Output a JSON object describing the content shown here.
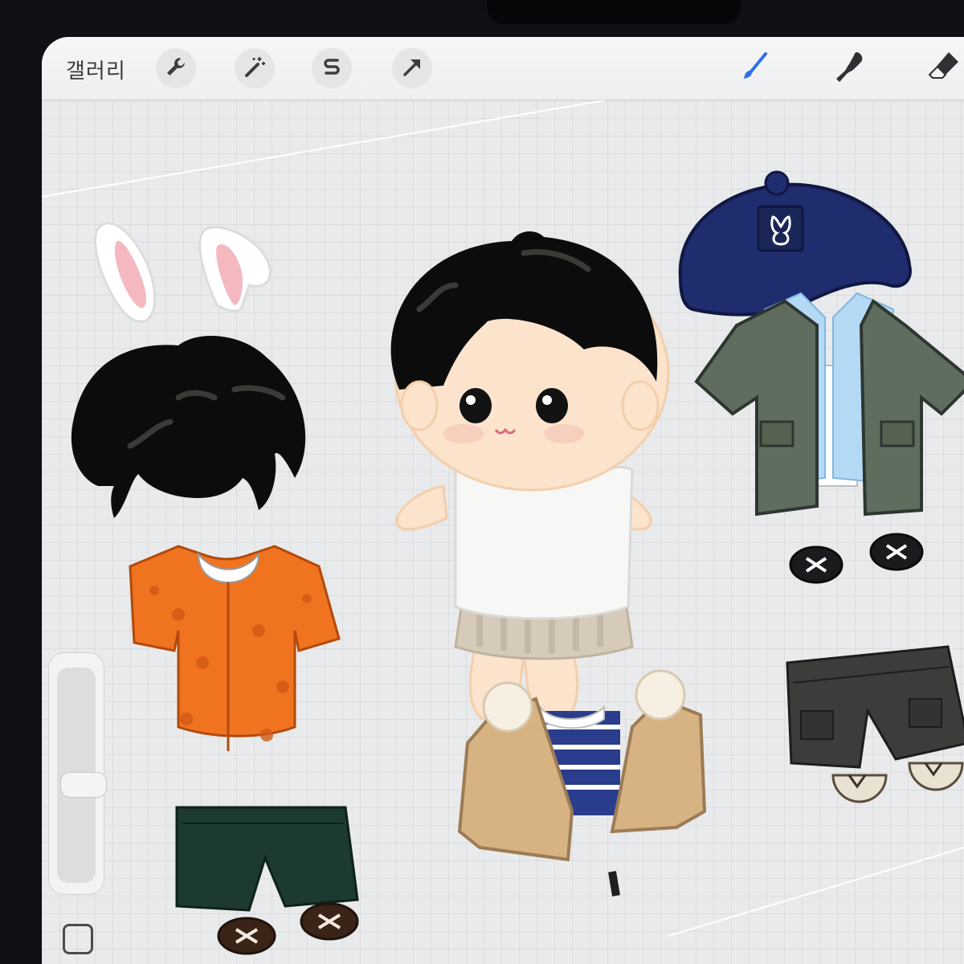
{
  "toolbar": {
    "gallery_label": "갤러리",
    "left_tools": [
      "wrench-icon",
      "magic-wand-icon",
      "selection-s-icon",
      "arrow-cursor-icon"
    ],
    "right_tools": [
      "brush-icon",
      "smudge-icon",
      "eraser-icon"
    ],
    "active_color": "#2f6fe8"
  },
  "sidebar": {
    "brush_size_slider": "brush-size-slider",
    "modify_button": "modify-square-button"
  },
  "canvas": {
    "items": [
      "bunny-ears",
      "doll-base",
      "navy-cap",
      "hair-piece",
      "green-jacket-outfit",
      "black-shoes",
      "orange-shirt",
      "dark-cargo-shorts",
      "beige-jacket-outfit",
      "green-shorts",
      "brown-shoes",
      "tan-shoes"
    ],
    "colors": {
      "orange": "#f0731f",
      "navy": "#1f2c6d",
      "olive": "#5f6d5f",
      "beige": "#d7b283",
      "skin": "#fbe3cc"
    }
  }
}
